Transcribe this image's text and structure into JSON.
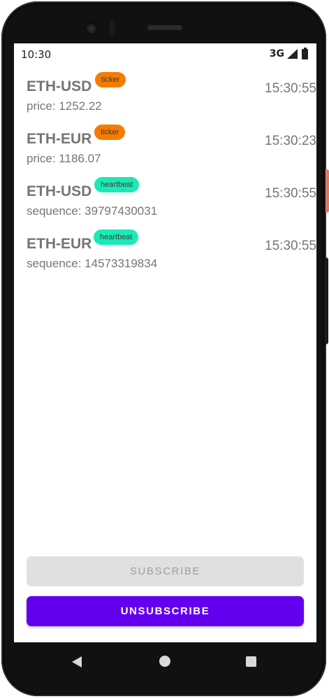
{
  "status": {
    "time": "10:30",
    "network": "3G"
  },
  "messages": [
    {
      "pair": "ETH-USD",
      "type": "ticker",
      "detail": "price: 1252.22",
      "time": "15:30:55",
      "badge_color": "#f57c00"
    },
    {
      "pair": "ETH-EUR",
      "type": "ticker",
      "detail": "price: 1186.07",
      "time": "15:30:23",
      "badge_color": "#f57c00"
    },
    {
      "pair": "ETH-USD",
      "type": "heartbeat",
      "detail": "sequence: 39797430031",
      "time": "15:30:55",
      "badge_color": "#1de9b6"
    },
    {
      "pair": "ETH-EUR",
      "type": "heartbeat",
      "detail": "sequence: 14573319834",
      "time": "15:30:55",
      "badge_color": "#1de9b6"
    }
  ],
  "buttons": {
    "subscribe": "SUBSCRIBE",
    "unsubscribe": "UNSUBSCRIBE"
  },
  "colors": {
    "accent": "#6200ee",
    "ticker": "#f57c00",
    "heartbeat": "#1de9b6"
  },
  "icons": {
    "signal": "signal-icon",
    "battery": "battery-icon",
    "back": "back-icon",
    "home": "home-icon",
    "recents": "recents-icon"
  }
}
